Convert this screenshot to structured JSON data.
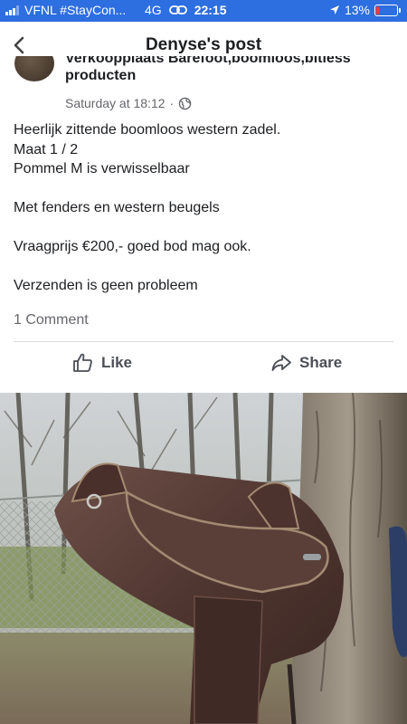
{
  "status_bar": {
    "carrier": "VFNL #StayCon...",
    "network": "4G",
    "time": "22:15",
    "battery": "13%",
    "battery_level": 0.13,
    "battery_color": "#ff3b30",
    "bar_color": "#2d6ee0"
  },
  "nav": {
    "title": "Denyse's post",
    "back_icon": "chevron-left-icon"
  },
  "post": {
    "author_line1": "Verkoopplaats Barefoot,boomloos,bitless",
    "author_line2": "producten",
    "timestamp": "Saturday at 18:12",
    "separator": "·",
    "audience_icon": "globe-icon",
    "lines": [
      "Heerlijk zittende boomloos western zadel.",
      "Maat 1 / 2",
      "Pommel M is verwisselbaar",
      "",
      "Met fenders en western beugels",
      "",
      "Vraagprijs €200,- goed bod mag ook.",
      "",
      "Verzenden is geen probleem"
    ],
    "comment_count": "1 Comment"
  },
  "actions": {
    "like_label": "Like",
    "share_label": "Share"
  }
}
